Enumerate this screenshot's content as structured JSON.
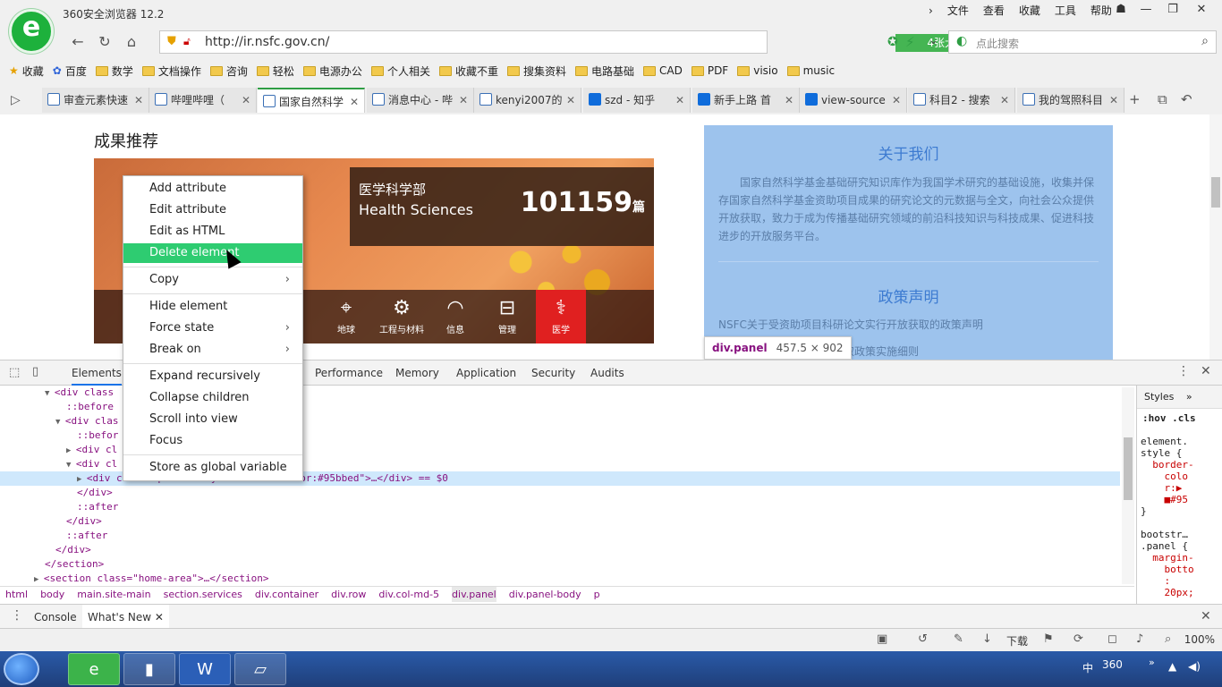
{
  "browser": {
    "app_title": "360安全浏览器 12.2",
    "menu": [
      "文件",
      "查看",
      "收藏",
      "工具",
      "帮助"
    ],
    "url": "http://ir.nsfc.gov.cn/",
    "big_image_label": "4张大图",
    "search_placeholder": "点此搜索"
  },
  "bookmarks": [
    {
      "label": "收藏",
      "folder": false
    },
    {
      "label": "百度",
      "folder": false
    },
    {
      "label": "数学",
      "folder": true
    },
    {
      "label": "文档操作",
      "folder": true
    },
    {
      "label": "咨询",
      "folder": true
    },
    {
      "label": "轻松",
      "folder": true
    },
    {
      "label": "电源办公",
      "folder": true
    },
    {
      "label": "个人相关",
      "folder": true
    },
    {
      "label": "收藏不重",
      "folder": true
    },
    {
      "label": "搜集资料",
      "folder": true
    },
    {
      "label": "电路基础",
      "folder": true
    },
    {
      "label": "CAD",
      "folder": true
    },
    {
      "label": "PDF",
      "folder": true
    },
    {
      "label": "visio",
      "folder": true
    },
    {
      "label": "music",
      "folder": true
    }
  ],
  "tabs": [
    {
      "label": "审查元素快速",
      "active": false
    },
    {
      "label": "哔哩哔哩（",
      "active": false
    },
    {
      "label": "国家自然科学",
      "active": true
    },
    {
      "label": "消息中心 - 哔",
      "active": false
    },
    {
      "label": "kenyi2007的",
      "active": false
    },
    {
      "label": "szd - 知乎",
      "active": false
    },
    {
      "label": "新手上路 首",
      "active": false
    },
    {
      "label": "view-source",
      "active": false
    },
    {
      "label": "科目2 - 搜索",
      "active": false
    },
    {
      "label": "我的驾照科目",
      "active": false
    }
  ],
  "page": {
    "results_title": "成果推荐",
    "dept_cn": "医学科学部",
    "dept_en": "Health Sciences",
    "dept_count": "101159",
    "dept_count_unit": "篇",
    "strip": [
      {
        "label": "地球",
        "active": false
      },
      {
        "label": "工程与材料",
        "active": false
      },
      {
        "label": "信息",
        "active": false
      },
      {
        "label": "管理",
        "active": false
      },
      {
        "label": "医学",
        "active": true
      }
    ],
    "about_title": "关于我们",
    "about_body": "国家自然科学基金基础研究知识库作为我国学术研究的基础设施，收集并保存国家自然科学基金资助项目成果的研究论文的元数据与全文，向社会公众提供开放获取，致力于成为传播基础研究领域的前沿科技知识与科技成果、促进科技进步的开放服务平台。",
    "policy_title": "政策声明",
    "policy_1": "NSFC关于受资助项目科研论文实行开放获取的政策声明",
    "policy_2": "开放获取政策实施细则",
    "tooltip_tag": "div.panel",
    "tooltip_dims": "457.5 × 902"
  },
  "devtools": {
    "tabs": [
      "Elements",
      "Performance",
      "Memory",
      "Application",
      "Security",
      "Audits"
    ],
    "dom_lines": [
      {
        "indent": 4,
        "arrow": "▼",
        "text": "<div class",
        "sel": false
      },
      {
        "indent": 6,
        "arrow": "",
        "text": "::before",
        "sel": false
      },
      {
        "indent": 5,
        "arrow": "▼",
        "text": "<div clas",
        "sel": false
      },
      {
        "indent": 7,
        "arrow": "",
        "text": "::befor",
        "sel": false
      },
      {
        "indent": 6,
        "arrow": "▶",
        "text": "<div cl                                 …</div>",
        "sel": false
      },
      {
        "indent": 6,
        "arrow": "▼",
        "text": "<div cl",
        "sel": false
      },
      {
        "indent": 7,
        "arrow": "▶",
        "text": "<div class=\"panel\" style=\"border-color:#95bbed\">…</div> == $0",
        "sel": true
      },
      {
        "indent": 7,
        "arrow": "",
        "text": "</div>",
        "sel": false
      },
      {
        "indent": 7,
        "arrow": "",
        "text": "::after",
        "sel": false
      },
      {
        "indent": 6,
        "arrow": "",
        "text": "</div>",
        "sel": false
      },
      {
        "indent": 6,
        "arrow": "",
        "text": "::after",
        "sel": false
      },
      {
        "indent": 5,
        "arrow": "",
        "text": "</div>",
        "sel": false
      },
      {
        "indent": 4,
        "arrow": "",
        "text": "</section>",
        "sel": false
      },
      {
        "indent": 3,
        "arrow": "▶",
        "text": "<section class=\"home-area\">…</section>",
        "sel": false
      }
    ],
    "breadcrumbs": [
      "html",
      "body",
      "main.site-main",
      "section.services",
      "div.container",
      "div.row",
      "div.col-md-5",
      "div.panel",
      "div.panel-body",
      "p"
    ],
    "styles_tab": "Styles",
    "styles_filter": ":hov .cls",
    "styles_lines": [
      "element.",
      "style {",
      "  border-",
      "    colo",
      "    r:▶",
      "    ■#95",
      "}",
      "",
      "bootstr…",
      ".panel {",
      "  margin-",
      "    botto",
      "    :",
      "    20px;"
    ],
    "drawer_tabs": [
      "Console",
      "What's New"
    ],
    "download_label": "下载",
    "zoom": "100%"
  },
  "context_menu": {
    "items": [
      {
        "label": "Add attribute",
        "submenu": false,
        "hl": false,
        "sep_after": false
      },
      {
        "label": "Edit attribute",
        "submenu": false,
        "hl": false,
        "sep_after": false
      },
      {
        "label": "Edit as HTML",
        "submenu": false,
        "hl": false,
        "sep_after": false
      },
      {
        "label": "Delete element",
        "submenu": false,
        "hl": true,
        "sep_after": true
      },
      {
        "label": "Copy",
        "submenu": true,
        "hl": false,
        "sep_after": true
      },
      {
        "label": "Hide element",
        "submenu": false,
        "hl": false,
        "sep_after": false
      },
      {
        "label": "Force state",
        "submenu": true,
        "hl": false,
        "sep_after": false
      },
      {
        "label": "Break on",
        "submenu": true,
        "hl": false,
        "sep_after": true
      },
      {
        "label": "Expand recursively",
        "submenu": false,
        "hl": false,
        "sep_after": false
      },
      {
        "label": "Collapse children",
        "submenu": false,
        "hl": false,
        "sep_after": false
      },
      {
        "label": "Scroll into view",
        "submenu": false,
        "hl": false,
        "sep_after": false
      },
      {
        "label": "Focus",
        "submenu": false,
        "hl": false,
        "sep_after": true
      },
      {
        "label": "Store as global variable",
        "submenu": false,
        "hl": false,
        "sep_after": false
      }
    ]
  },
  "taskbar": {
    "ime": "中",
    "tray_label": "360",
    "apps": [
      "360-browser-icon",
      "folder-icon",
      "word-icon",
      "notepad-icon"
    ]
  },
  "colors": {
    "highlight": "#2ecc71",
    "panel_border": "#95bbed",
    "accent_red": "#e02020"
  }
}
